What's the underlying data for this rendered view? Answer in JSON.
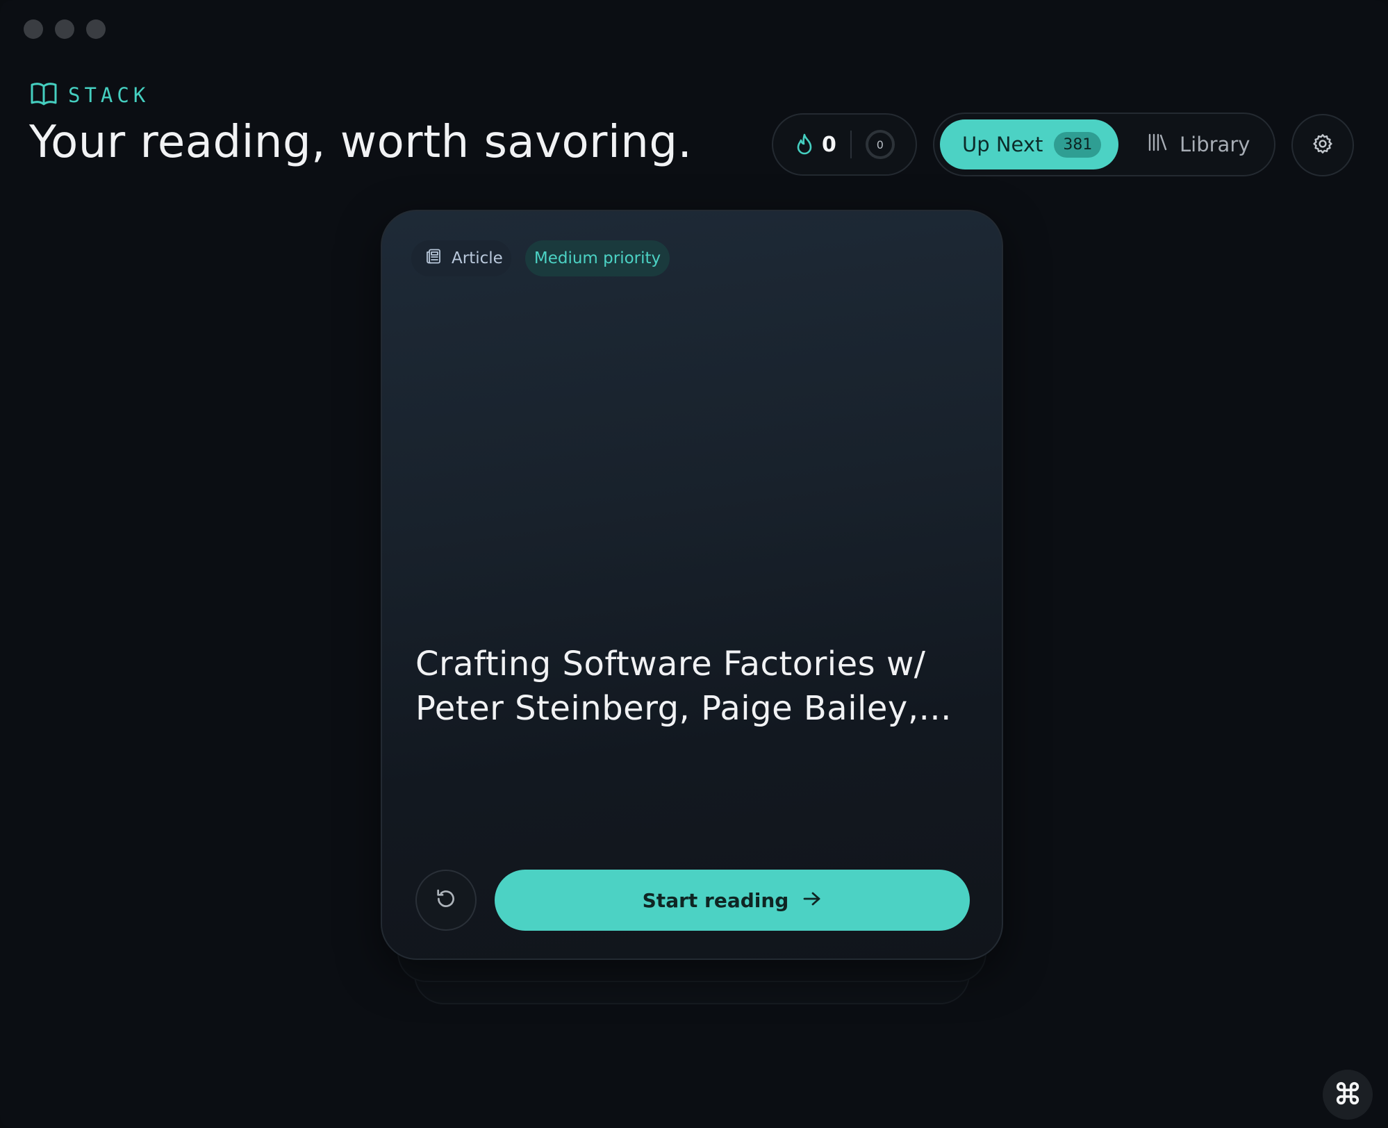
{
  "brand": {
    "name": "STACK",
    "accent": "#45cfc0",
    "icon": "open-book-icon"
  },
  "headline": "Your reading, worth savoring.",
  "streak": {
    "icon": "flame-icon",
    "count": "0",
    "ring_value": "0"
  },
  "nav": {
    "up_next_label": "Up Next",
    "up_next_count": "381",
    "library_label": "Library",
    "library_icon": "library-books-icon"
  },
  "settings_icon": "gear-icon",
  "card": {
    "type_label": "Article",
    "type_icon": "newspaper-icon",
    "priority_label": "Medium priority",
    "title": "Crafting Software Factories w/ Peter Steinberg, Paige Bailey,...",
    "undo_icon": "undo-icon",
    "start_label": "Start reading",
    "start_icon": "arrow-right-icon"
  },
  "corner_icon": "command-icon"
}
